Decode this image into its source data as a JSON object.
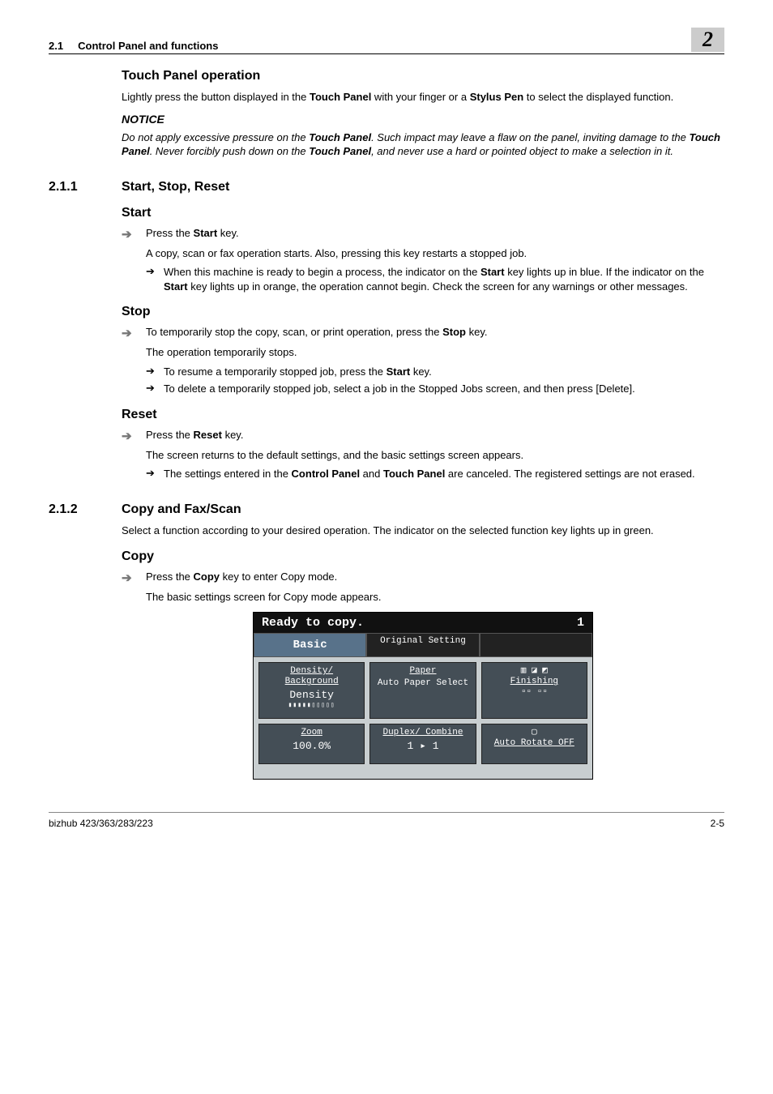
{
  "header": {
    "section_ref": "2.1",
    "section_title": "Control Panel and functions",
    "chapter_number": "2"
  },
  "touch_panel_op": {
    "heading": "Touch Panel operation",
    "intro_before": "Lightly press the button displayed in the ",
    "touch_panel_bold": "Touch Panel",
    "intro_mid": " with your finger or a ",
    "stylus_bold": "Stylus Pen",
    "intro_after": " to select the displayed function.",
    "notice_label": "NOTICE",
    "notice_a": "Do not apply excessive pressure on the ",
    "notice_b": ". Such impact may leave a flaw on the panel, inviting damage to the ",
    "notice_c": ". Never forcibly push down on the ",
    "notice_d": ", and never use a hard or pointed object to make a selection in it."
  },
  "sec_211": {
    "num": "2.1.1",
    "title": "Start, Stop, Reset"
  },
  "start": {
    "heading": "Start",
    "press_before": "Press the ",
    "press_bold": "Start",
    "press_after": " key.",
    "line2": "A copy, scan or fax operation starts. Also, pressing this key restarts a stopped job.",
    "b1a": "When this machine is ready to begin a process, the indicator on the ",
    "b1b": " key lights up in blue. If the indicator on the ",
    "b1c": " key lights up in orange, the operation cannot begin. Check the screen for any warnings or other messages."
  },
  "stop": {
    "heading": "Stop",
    "s1a": "To temporarily stop the copy, scan, or print operation, press the ",
    "s1b": "Stop",
    "s1c": " key.",
    "line2": "The operation temporarily stops.",
    "b1a": "To resume a temporarily stopped job, press the ",
    "b1b": " key.",
    "b2": "To delete a temporarily stopped job, select a job in the Stopped Jobs screen, and then press [Delete]."
  },
  "reset": {
    "heading": "Reset",
    "r1a": "Press the ",
    "r1b": "Reset",
    "r1c": " key.",
    "line2": "The screen returns to the default settings, and the basic settings screen appears.",
    "b1a": "The settings entered in the ",
    "b1_cp": "Control Panel",
    "b1b": " and ",
    "b1_tp": "Touch Panel",
    "b1c": " are canceled. The registered settings are not erased."
  },
  "sec_212": {
    "num": "2.1.2",
    "title": "Copy and Fax/Scan",
    "intro": "Select a function according to your desired operation. The indicator on the selected function key lights up in green."
  },
  "copy": {
    "heading": "Copy",
    "c1a": "Press the ",
    "c1b": "Copy",
    "c1c": " key to enter Copy mode.",
    "line2": "The basic settings screen for Copy mode appears."
  },
  "panel": {
    "status": "Ready to copy.",
    "count": "1",
    "tab_basic": "Basic",
    "tab_original": "Original Setting",
    "density_title": "Density/ Background",
    "density_val": "Density",
    "paper_title": "Paper",
    "paper_val": "Auto Paper Select",
    "finishing": "Finishing",
    "zoom_title": "Zoom",
    "zoom_val": "100.0%",
    "duplex_title": "Duplex/ Combine",
    "duplex_val": "1 ▸ 1",
    "autorotate": "Auto Rotate OFF"
  },
  "footer": {
    "model": "bizhub 423/363/283/223",
    "page": "2-5"
  }
}
